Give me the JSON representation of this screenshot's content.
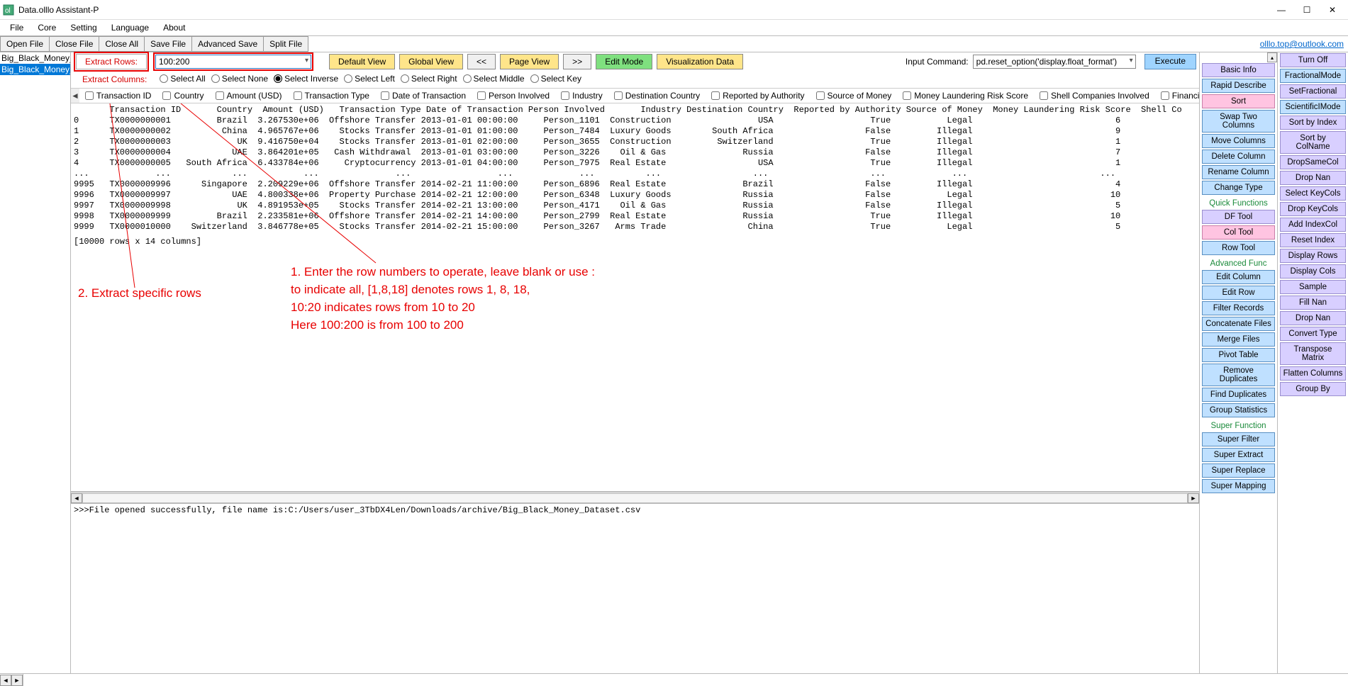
{
  "window": {
    "title": "Data.olllo Assistant-P"
  },
  "menus": [
    "File",
    "Core",
    "Setting",
    "Language",
    "About"
  ],
  "toolbar1": [
    "Open File",
    "Close File",
    "Close All",
    "Save File",
    "Advanced Save",
    "Split File"
  ],
  "toolbar_right_link": "olllo.top@outlook.com",
  "files": [
    {
      "label": "Big_Black_Money_Data",
      "selected": false
    },
    {
      "label": "Big_Black_Money_Data",
      "selected": true
    }
  ],
  "ctrl": {
    "extract_rows_label": "Extract Rows:",
    "rows_value": "100:200",
    "default_view": "Default View",
    "global_view": "Global View",
    "prev": "<<",
    "page_view": "Page View",
    "next": ">>",
    "edit_mode": "Edit Mode",
    "viz": "Visualization Data",
    "input_cmd_label": "Input Command:",
    "input_cmd_value": "pd.reset_option('display.float_format')",
    "execute": "Execute",
    "extract_cols_label": "Extract Columns:",
    "radios": [
      "Select All",
      "Select None",
      "Select Inverse",
      "Select Left",
      "Select Right",
      "Select Middle",
      "Select Key"
    ],
    "radio_selected": 2
  },
  "columns": [
    "Transaction ID",
    "Country",
    "Amount (USD)",
    "Transaction Type",
    "Date of Transaction",
    "Person Involved",
    "Industry",
    "Destination Country",
    "Reported by Authority",
    "Source of Money",
    "Money Laundering Risk Score",
    "Shell Companies Involved",
    "Financial"
  ],
  "data_header": "       Transaction ID       Country  Amount (USD)   Transaction Type Date of Transaction Person Involved       Industry Destination Country  Reported by Authority Source of Money  Money Laundering Risk Score  Shell Co",
  "data_rows": [
    "0      TX0000000001         Brazil  3.267530e+06  Offshore Transfer 2013-01-01 00:00:00     Person_1101  Construction                 USA                   True           Legal                            6",
    "1      TX0000000002          China  4.965767e+06    Stocks Transfer 2013-01-01 01:00:00     Person_7484  Luxury Goods        South Africa                  False         Illegal                            9",
    "2      TX0000000003             UK  9.416750e+04    Stocks Transfer 2013-01-01 02:00:00     Person_3655  Construction         Switzerland                   True         Illegal                            1",
    "3      TX0000000004            UAE  3.864201e+05   Cash Withdrawal  2013-01-01 03:00:00     Person_3226    Oil & Gas               Russia                  False         Illegal                            7",
    "4      TX0000000005   South Africa  6.433784e+06     Cryptocurrency 2013-01-01 04:00:00     Person_7975  Real Estate                  USA                   True         Illegal                            1",
    "...             ...            ...           ...               ...                 ...             ...          ...                  ...                    ...             ...                          ...",
    "9995   TX0000009996      Singapore  2.209229e+06  Offshore Transfer 2014-02-21 11:00:00     Person_6896  Real Estate               Brazil                  False         Illegal                            4",
    "9996   TX0000009997            UAE  4.800338e+06  Property Purchase 2014-02-21 12:00:00     Person_6348  Luxury Goods              Russia                  False           Legal                           10",
    "9997   TX0000009998             UK  4.891953e+05    Stocks Transfer 2014-02-21 13:00:00     Person_4171    Oil & Gas               Russia                  False         Illegal                            5",
    "9998   TX0000009999         Brazil  2.233581e+06  Offshore Transfer 2014-02-21 14:00:00     Person_2799  Real Estate               Russia                   True         Illegal                           10",
    "9999   TX0000010000    Switzerland  3.846778e+05    Stocks Transfer 2014-02-21 15:00:00     Person_3267   Arms Trade                China                   True           Legal                            5"
  ],
  "data_footer": "[10000 rows x 14 columns]",
  "log_line": ">>>File opened successfully, file name is:C:/Users/user_3TbDX4Len/Downloads/archive/Big_Black_Money_Dataset.csv",
  "annotations": {
    "step2": "2. Extract specific rows",
    "step1a": "1. Enter the row numbers to operate, leave blank or use :",
    "step1b": "to indicate all, [1,8,18] denotes rows 1, 8, 18,",
    "step1c": "10:20 indicates rows from 10 to 20",
    "step1d": "Here 100:200 is from 100 to 200"
  },
  "right1": [
    {
      "t": "Basic Info",
      "c": "lav"
    },
    {
      "t": "Rapid Describe"
    },
    {
      "t": "Sort",
      "c": "pink"
    },
    {
      "t": "Swap Two Columns"
    },
    {
      "t": "Move Columns"
    },
    {
      "t": "Delete Column"
    },
    {
      "t": "Rename Column"
    },
    {
      "t": "Change Type"
    },
    {
      "t": "Quick Functions",
      "c": "section"
    },
    {
      "t": "DF Tool",
      "c": "lav"
    },
    {
      "t": "Col Tool",
      "c": "pink"
    },
    {
      "t": "Row Tool"
    },
    {
      "t": "Advanced Func",
      "c": "section"
    },
    {
      "t": "Edit Column"
    },
    {
      "t": "Edit Row"
    },
    {
      "t": "Filter Records"
    },
    {
      "t": "Concatenate Files"
    },
    {
      "t": "Merge Files"
    },
    {
      "t": "Pivot Table"
    },
    {
      "t": "Remove Duplicates"
    },
    {
      "t": "Find Duplicates"
    },
    {
      "t": "Group Statistics"
    },
    {
      "t": "Super Function",
      "c": "section"
    },
    {
      "t": "Super Filter"
    },
    {
      "t": "Super Extract"
    },
    {
      "t": "Super Replace"
    },
    {
      "t": "Super Mapping"
    }
  ],
  "right2": [
    {
      "t": "Turn Off",
      "c": "lav"
    },
    {
      "t": "FractionalMode"
    },
    {
      "t": "SetFractional",
      "c": "lav"
    },
    {
      "t": "ScientificIMode"
    },
    {
      "t": "Sort by Index",
      "c": "lav"
    },
    {
      "t": "Sort by ColName",
      "c": "lav"
    },
    {
      "t": "DropSameCol",
      "c": "lav"
    },
    {
      "t": "Drop Nan",
      "c": "lav"
    },
    {
      "t": "Select KeyCols",
      "c": "lav"
    },
    {
      "t": "Drop KeyCols",
      "c": "lav"
    },
    {
      "t": "Add IndexCol",
      "c": "lav"
    },
    {
      "t": "Reset Index",
      "c": "lav"
    },
    {
      "t": "Display Rows",
      "c": "lav"
    },
    {
      "t": "Display Cols",
      "c": "lav"
    },
    {
      "t": "Sample",
      "c": "lav"
    },
    {
      "t": "Fill Nan",
      "c": "lav"
    },
    {
      "t": "Drop Nan",
      "c": "lav"
    },
    {
      "t": "Convert Type",
      "c": "lav"
    },
    {
      "t": "Transpose Matrix",
      "c": "lav"
    },
    {
      "t": "Flatten Columns",
      "c": "lav"
    },
    {
      "t": "Group By",
      "c": "lav"
    }
  ]
}
